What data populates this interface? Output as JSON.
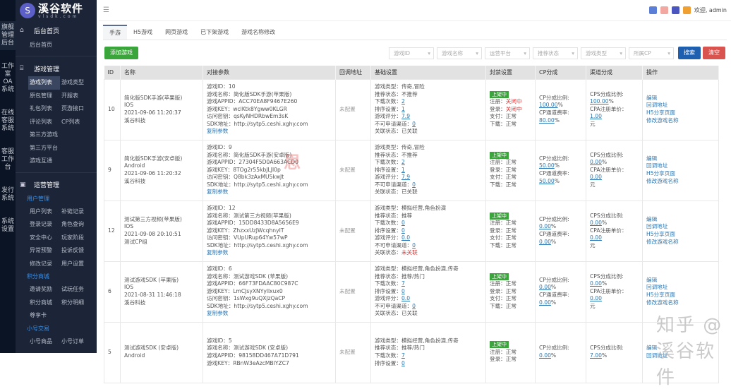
{
  "systems": [
    "旗舰管理后台",
    "工作室OA系统",
    "在线客服系统",
    "客服工作台",
    "发行系统",
    "系统设置"
  ],
  "logo": {
    "name": "溪谷软件",
    "domain": "vlsdk.com"
  },
  "nav": {
    "home": {
      "title": "后台首页",
      "items": [
        "后台首页"
      ]
    },
    "game": {
      "title": "游戏管理",
      "items": [
        "游戏列表",
        "游戏类型",
        "原包管理",
        "开服表",
        "礼包列表",
        "页游接口",
        "评论列表",
        "CP列表",
        "第三方游戏",
        "第三方平台",
        "游戏互通"
      ]
    },
    "ops": {
      "title": "运营管理",
      "groups": [
        {
          "label": "用户管理",
          "items": [
            "用户列表",
            "补链记录",
            "登录记录",
            "角色查询",
            "安全中心",
            "玩家阶段",
            "异常预警",
            "投诉反馈",
            "修改记录",
            "用户设置"
          ]
        },
        {
          "label": "积分商城",
          "items": [
            "邀请奖励",
            "试玩任务",
            "积分商城",
            "积分明细",
            "尊享卡"
          ]
        },
        {
          "label": "小号交易",
          "items": [
            "小号商品",
            "小号订单"
          ]
        }
      ]
    }
  },
  "topbar": {
    "welcome": "欢迎, admin"
  },
  "tabs": [
    "手游",
    "H5游戏",
    "网页游戏",
    "已下架游戏",
    "游戏名称修改"
  ],
  "toolbar": {
    "add": "添加游戏",
    "filters": [
      "游戏ID",
      "游戏名称",
      "运营平台",
      "推荐状态",
      "游戏类型",
      "所属CP"
    ],
    "search": "搜索",
    "clear": "清空"
  },
  "table": {
    "headers": [
      "ID",
      "名称",
      "对接参数",
      "回调地址",
      "基础设置",
      "封禁设置",
      "CP分成",
      "渠道分成",
      "操作"
    ],
    "rows": [
      {
        "id": "10",
        "name": "简化版SDK手游(苹果版)",
        "platform": "IOS",
        "time": "2021-09-06 11:20:37",
        "cp": "溪谷科技",
        "params": [
          "游戏ID：10",
          "游戏名称：简化版SDK手游(苹果版)",
          "游戏APPID：ACC70EA8F9467E260",
          "游戏KEY：wclKtk8Ygww0KLGR",
          "访问密钥：qsKyNHDRbwEm3sK",
          "SDK地址：http://sytp5.ceshi.xghy.com"
        ],
        "copy": "复制参数",
        "callback": "未配置",
        "basic": {
          "type": "传奇,冒险",
          "rec": "不推荐",
          "downloads": "2",
          "sort": "1",
          "score": "7.9",
          "channel": "0",
          "link": "已关联"
        },
        "ban": {
          "status": "上架中",
          "reg": "关闭中",
          "login": "关闭中",
          "pay": "正常",
          "down": "正常"
        },
        "cpshare": {
          "ratio": "100.00",
          "fee": "80.00"
        },
        "chshare": {
          "cps": "100.00",
          "cpa": "1.00"
        },
        "ops": [
          "编辑",
          "回调地址",
          "H5分享页面",
          "修改游戏名称"
        ]
      },
      {
        "id": "9",
        "name": "简化版SDK手游(安卓版)",
        "platform": "Android",
        "time": "2021-09-06 11:20:32",
        "cp": "溪谷科技",
        "params": [
          "游戏ID：9",
          "游戏名称：简化版SDK手游(安卓版)",
          "游戏APPID：27304F5D0A663ACD0",
          "游戏KEY：8TOg2r55kbJLJl0p",
          "访问密钥：Q8bk3zAxMU5kwJt",
          "SDK地址：http://sytp5.ceshi.xghy.com"
        ],
        "copy": "复制参数",
        "callback": "未配置",
        "basic": {
          "type": "传奇,冒险",
          "rec": "不推荐",
          "downloads": "2",
          "sort": "1",
          "score": "7.9",
          "channel": "0",
          "link": "已关联"
        },
        "ban": {
          "status": "上架中",
          "reg": "正常",
          "login": "正常",
          "pay": "正常",
          "down": "正常"
        },
        "cpshare": {
          "ratio": "50.00",
          "fee": "50.00"
        },
        "chshare": {
          "cps": "0.00",
          "cpa": "0.00"
        },
        "ops": [
          "编辑",
          "回调地址",
          "H5分享页面",
          "修改游戏名称"
        ]
      },
      {
        "id": "12",
        "name": "测试第三方视频(苹果版)",
        "platform": "IOS",
        "time": "2021-09-08 20:10:51",
        "cp": "测试CP组",
        "params": [
          "游戏ID：12",
          "游戏名称：测试第三方视频(苹果版)",
          "游戏APPID：15DD8433D8A5656E9",
          "游戏KEY：ZhzxxUzJWcqhnyIT",
          "访问密钥：VUpURup64Yw57wP",
          "SDK地址：http://sytp5.ceshi.xghy.com"
        ],
        "copy": "复制参数",
        "callback": "未配置",
        "basic": {
          "type": "模拟经营,角色扮演",
          "rec": "推荐",
          "downloads": "0",
          "sort": "0",
          "score": "0.0",
          "channel": "0",
          "link": "未关联"
        },
        "ban": {
          "status": "上架中",
          "reg": "正常",
          "login": "正常",
          "pay": "正常",
          "down": "正常"
        },
        "cpshare": {
          "ratio": "0.00",
          "fee": "0.00"
        },
        "chshare": {
          "cps": "0.00",
          "cpa": "0.00"
        },
        "ops": [
          "编辑",
          "回调地址",
          "H5分享页面",
          "修改游戏名称"
        ]
      },
      {
        "id": "6",
        "name": "测试游戏SDK (苹果版)",
        "platform": "IOS",
        "time": "2021-08-31 11:46:18",
        "cp": "溪谷科技",
        "params": [
          "游戏ID：6",
          "游戏名称：测试游戏SDK (苹果版)",
          "游戏APPID：66F73FDAAC80C987C",
          "游戏KEY：LmCJsyXNYyllxux0",
          "访问密钥：1sWxg9uQXJzQaCP",
          "SDK地址：http://sytp5.ceshi.xghy.com"
        ],
        "copy": "复制参数",
        "callback": "未配置",
        "basic": {
          "type": "模拟经营,角色扮演,传奇",
          "rec": "推荐/热门",
          "downloads": "7",
          "sort": "0",
          "score": "0.0",
          "channel": "0",
          "link": "已关联"
        },
        "ban": {
          "status": "上架中",
          "reg": "正常",
          "login": "正常",
          "pay": "正常",
          "down": "正常"
        },
        "cpshare": {
          "ratio": "0.00",
          "fee": "0.00"
        },
        "chshare": {
          "cps": "0.00",
          "cpa": "0.00"
        },
        "ops": [
          "编辑",
          "回调地址",
          "H5分享页面",
          "修改游戏名称"
        ]
      },
      {
        "id": "5",
        "name": "测试游戏SDK (安卓版)",
        "platform": "Android",
        "time": "",
        "cp": "",
        "params": [
          "游戏ID：5",
          "游戏名称：测试游戏SDK (安卓版)",
          "游戏APPID：98158DD467A71D791",
          "游戏KEY：RBnW3eAzcMBIYZC7"
        ],
        "copy": "",
        "callback": "未配置",
        "basic": {
          "type": "模拟经营,角色扮演,传奇",
          "rec": "推荐/热门",
          "downloads": "7",
          "sort": "0"
        },
        "ban": {
          "status": "上架中",
          "reg": "正常",
          "login": "正常"
        },
        "cpshare": {
          "ratio": "0.00"
        },
        "chshare": {
          "cps": "7.00"
        },
        "ops": [
          "编辑",
          "回调地址"
        ]
      }
    ]
  },
  "labels": {
    "type": "游戏类型：",
    "rec": "推荐状态：",
    "downloads": "下载次数：",
    "sort": "排序设置：",
    "score": "游戏评分：",
    "channel": "不可申请渠道：",
    "link": "关联状态：",
    "reg": "注册：",
    "login": "登录：",
    "pay": "支付：",
    "down": "下载：",
    "cpratio": "CP分成比例:",
    "cpfee": "CP通道费率:",
    "cps": "CPS分成比例:",
    "cpa": "CPA注册单价：",
    "yuan": "元"
  },
  "watermark": "知乎 @溪谷软件",
  "watermark2": "思"
}
